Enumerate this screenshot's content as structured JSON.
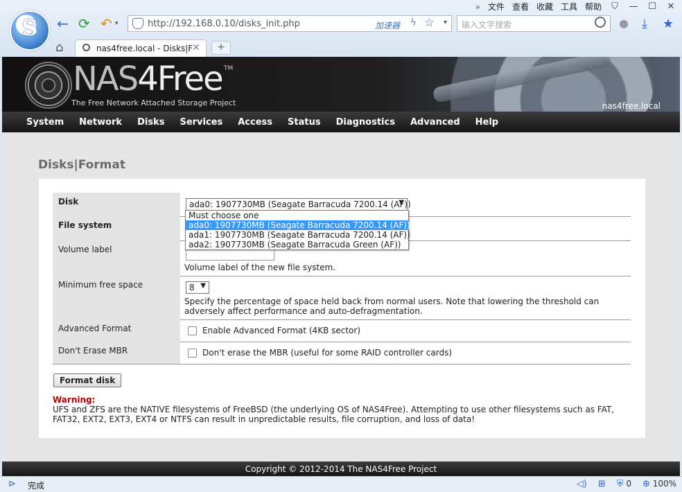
{
  "browser": {
    "menu": [
      "文件",
      "查看",
      "收藏",
      "工具",
      "帮助"
    ],
    "window_controls": [
      "shirt-icon",
      "minimize-icon",
      "maximize-icon",
      "close-icon"
    ],
    "address": "http://192.168.0.10/disks_init.php",
    "accelerator_label": "加速器",
    "search_placeholder": "输入文字搜索",
    "tab_title": "nas4free.local - Disks|F",
    "status_text": "完成",
    "status_blocked_count": "0",
    "zoom": "100%"
  },
  "header": {
    "brand_prefix": "NAS",
    "brand_suffix": "4Free",
    "trademark": "TM",
    "subtitle": "The Free Network Attached Storage Project",
    "hostname": "nas4free.local"
  },
  "nav": [
    "System",
    "Network",
    "Disks",
    "Services",
    "Access",
    "Status",
    "Diagnostics",
    "Advanced",
    "Help"
  ],
  "page": {
    "title": "Disks|Format",
    "disk_label": "Disk",
    "disk_value": "ada0: 1907730MB (Seagate Barracuda 7200.14 (AF))",
    "disk_options": [
      "Must choose one",
      "ada0: 1907730MB (Seagate Barracuda 7200.14 (AF))",
      "ada1: 1907730MB (Seagate Barracuda 7200.14 (AF))",
      "ada2: 1907730MB (Seagate Barracuda Green (AF))"
    ],
    "filesystem_label": "File system",
    "volume_label": "Volume label",
    "volume_hint": "Volume label of the new file system.",
    "minfree_label": "Minimum free space",
    "minfree_value": "8",
    "minfree_hint": "Specify the percentage of space held back from normal users. Note that lowering the threshold can adversely affect performance and auto-defragmentation.",
    "advformat_label": "Advanced Format",
    "advformat_option": "Enable Advanced Format (4KB sector)",
    "mbr_label": "Don't Erase MBR",
    "mbr_option": "Don't erase the MBR (useful for some RAID controller cards)",
    "format_button": "Format disk",
    "warning_title": "Warning:",
    "warning_text": "UFS and ZFS are the NATIVE filesystems of FreeBSD (the underlying OS of NAS4Free). Attempting to use other filesystems such as FAT, FAT32, EXT2, EXT3, EXT4 or NTFS can result in unpredictable results, file corruption, and loss of data!",
    "copyright": "Copyright © 2012-2014 The NAS4Free Project"
  }
}
